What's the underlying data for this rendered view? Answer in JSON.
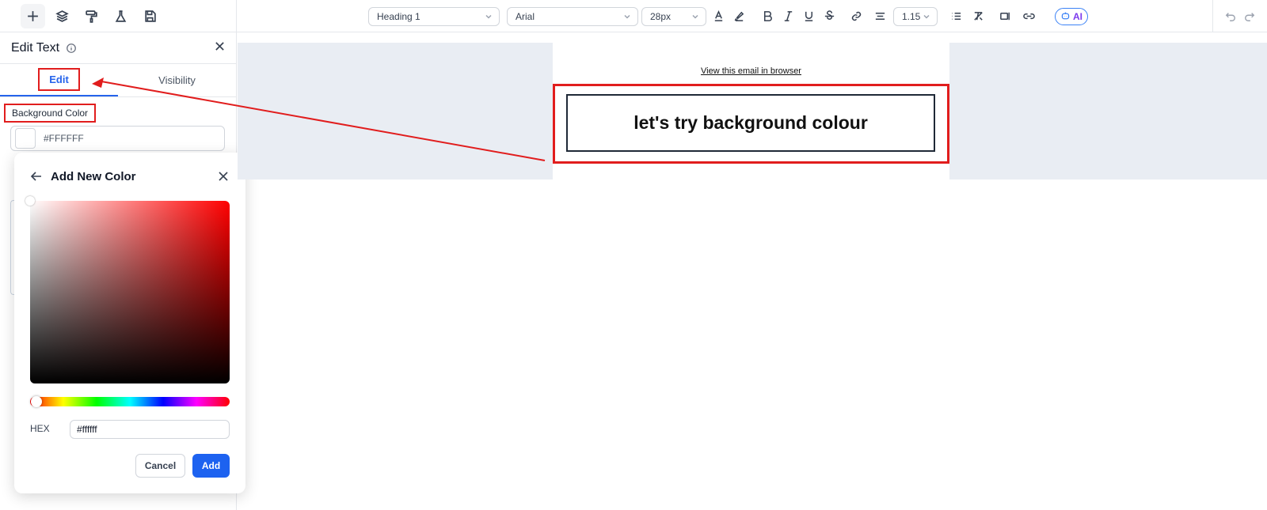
{
  "toolbar": {
    "block_style": "Heading 1",
    "font_family": "Arial",
    "font_size": "28px",
    "line_height": "1.15",
    "ai_label": "AI"
  },
  "sidebar": {
    "title": "Edit Text",
    "tabs": [
      {
        "label": "Edit",
        "active": true
      },
      {
        "label": "Visibility",
        "active": false
      }
    ],
    "background_color_label": "Background Color",
    "background_color_value": "#FFFFFF"
  },
  "color_picker": {
    "title": "Add New Color",
    "hex_label": "HEX",
    "hex_value": "#ffffff",
    "cancel_label": "Cancel",
    "add_label": "Add"
  },
  "canvas": {
    "view_in_browser": "View this email in browser",
    "heading_text": "let's try background colour"
  },
  "colors": {
    "accent": "#2563eb",
    "annotation": "#e11d1d",
    "canvas_background": "#e9edf3"
  }
}
